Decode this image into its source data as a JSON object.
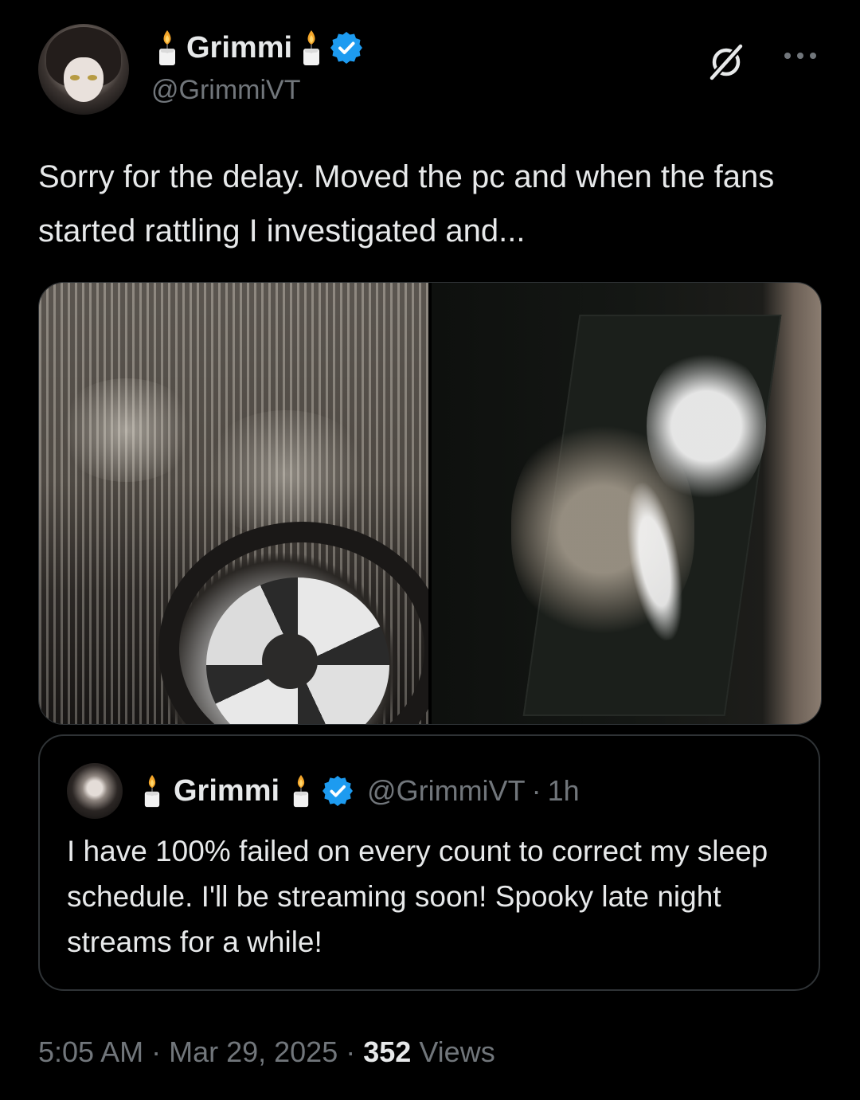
{
  "author": {
    "name": "Grimmi",
    "handle": "@GrimmiVT",
    "verified": true,
    "name_emoji": "candle-icon"
  },
  "tweet": {
    "text": "Sorry for the delay. Moved the pc and when the fans started rattling I investigated and...",
    "photos": [
      {
        "description_icon": "dusty-radiator-fan-photo"
      },
      {
        "description_icon": "dusty-case-panel-photo"
      }
    ]
  },
  "quoted": {
    "name": "Grimmi",
    "handle": "@GrimmiVT",
    "separator": "·",
    "time": "1h",
    "text": "I have 100% failed on every count to correct my sleep schedule. I'll be streaming soon! Spooky late night streams for a while!"
  },
  "meta": {
    "time": "5:05 AM",
    "dot": " · ",
    "date": "Mar 29, 2025",
    "dot2": " · ",
    "views_count": "352",
    "views_label": " Views"
  },
  "colors": {
    "background": "#000000",
    "text": "#e7e9ea",
    "muted": "#71767b",
    "border": "#2f3336",
    "verified_blue": "#1d9bf0"
  }
}
